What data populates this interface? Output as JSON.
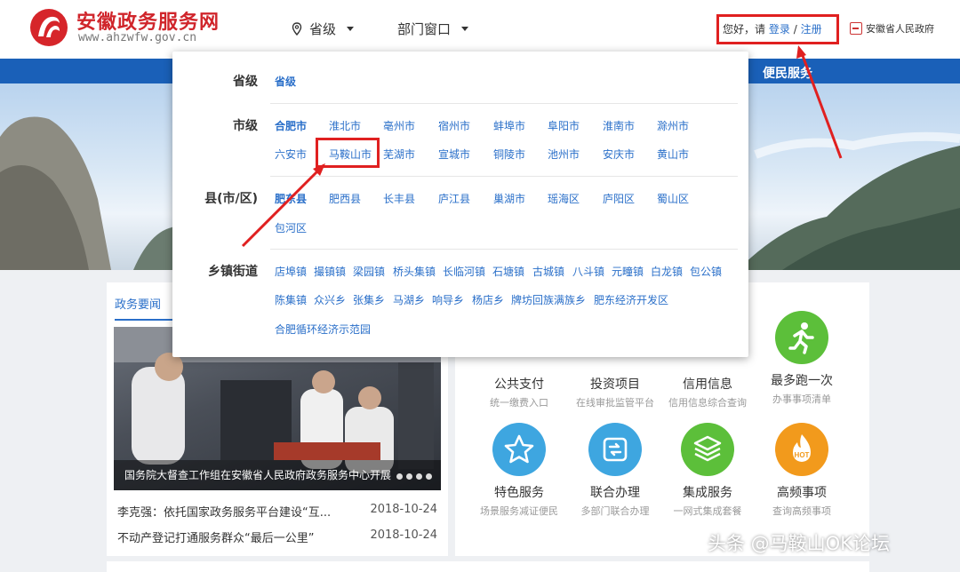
{
  "header": {
    "site_title": "安徽政务服务网",
    "site_url": "www.ahzwfw.gov.cn",
    "nav_province": "省级",
    "nav_dept": "部门窗口",
    "greeting": "您好，请",
    "login": "登录",
    "separator": "/",
    "register": "注册",
    "gov_link": "安徽省人民政府"
  },
  "bluebar": {
    "item_right": "便民服务"
  },
  "dropdown": {
    "province_label": "省级",
    "province_items": [
      "省级"
    ],
    "city_label": "市级",
    "city_items_row1": [
      "合肥市",
      "淮北市",
      "亳州市",
      "宿州市",
      "蚌埠市",
      "阜阳市",
      "淮南市",
      "滁州市"
    ],
    "city_items_row2": [
      "六安市",
      "马鞍山市",
      "芜湖市",
      "宣城市",
      "铜陵市",
      "池州市",
      "安庆市",
      "黄山市"
    ],
    "county_label": "县(市/区)",
    "county_items_row1": [
      "肥东县",
      "肥西县",
      "长丰县",
      "庐江县",
      "巢湖市",
      "瑶海区",
      "庐阳区",
      "蜀山区"
    ],
    "county_items_row2": [
      "包河区"
    ],
    "town_label": "乡镇街道",
    "town_items_row1": [
      "店埠镇",
      "撮镇镇",
      "梁园镇",
      "桥头集镇",
      "长临河镇",
      "石塘镇",
      "古城镇",
      "八斗镇",
      "元疃镇",
      "白龙镇",
      "包公镇"
    ],
    "town_items_row2": [
      "陈集镇",
      "众兴乡",
      "张集乡",
      "马湖乡",
      "响导乡",
      "杨店乡",
      "牌坊回族满族乡",
      "肥东经济开发区"
    ],
    "town_items_row3": [
      "合肥循环经济示范园"
    ]
  },
  "news": {
    "tab": "政务要闻",
    "caption": "国务院大督查工作组在安徽省人民政府政务服务中心开展",
    "items": [
      {
        "title": "李克强：依托国家政务服务平台建设“互...",
        "date": "2018-10-24"
      },
      {
        "title": "不动产登记打通服务群众“最后一公里”",
        "date": "2018-10-24"
      }
    ]
  },
  "services": [
    {
      "label": "公共支付",
      "sub": "统一缴费入口"
    },
    {
      "label": "投资项目",
      "sub": "在线审批监管平台"
    },
    {
      "label": "信用信息",
      "sub": "信用信息综合查询"
    },
    {
      "label": "最多跑一次",
      "sub": "办事事项清单",
      "icon": "running-man-icon",
      "color": "#5cbf3a"
    },
    {
      "label": "特色服务",
      "sub": "场景服务减证便民",
      "icon": "star-icon",
      "color": "#3ea6e0"
    },
    {
      "label": "联合办理",
      "sub": "多部门联合办理",
      "icon": "repeat-icon",
      "color": "#3ea6e0"
    },
    {
      "label": "集成服务",
      "sub": "一网式集成套餐",
      "icon": "layers-icon",
      "color": "#5cbf3a"
    },
    {
      "label": "高频事项",
      "sub": "查询高频事项",
      "icon": "fire-icon",
      "color": "#f29a1c",
      "badge": "HOT"
    }
  ],
  "watermark": "头条 @马鞍山OK论坛"
}
